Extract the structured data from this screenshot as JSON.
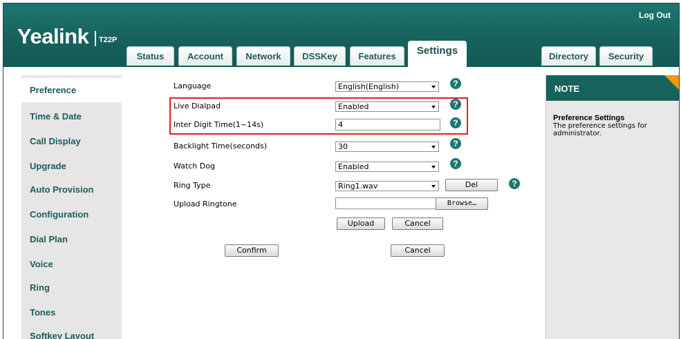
{
  "header": {
    "brand": "Yealink",
    "model": "T22P",
    "logout": "Log Out"
  },
  "tabs": [
    {
      "label": "Status"
    },
    {
      "label": "Account"
    },
    {
      "label": "Network"
    },
    {
      "label": "DSSKey"
    },
    {
      "label": "Features"
    },
    {
      "label": "Settings",
      "active": true
    },
    {
      "label": "Directory"
    },
    {
      "label": "Security"
    }
  ],
  "sidebar": {
    "items": [
      {
        "label": "Preference",
        "active": true
      },
      {
        "label": "Time & Date"
      },
      {
        "label": "Call Display"
      },
      {
        "label": "Upgrade"
      },
      {
        "label": "Auto Provision"
      },
      {
        "label": "Configuration"
      },
      {
        "label": "Dial Plan"
      },
      {
        "label": "Voice"
      },
      {
        "label": "Ring"
      },
      {
        "label": "Tones"
      },
      {
        "label": "Softkey Layout"
      }
    ]
  },
  "form": {
    "language": {
      "label": "Language",
      "value": "English(English)"
    },
    "live_dialpad": {
      "label": "Live Dialpad",
      "value": "Enabled"
    },
    "inter_digit": {
      "label": "Inter Digit Time(1~14s)",
      "value": "4"
    },
    "backlight": {
      "label": "Backlight Time(seconds)",
      "value": "30"
    },
    "watch_dog": {
      "label": "Watch Dog",
      "value": "Enabled"
    },
    "ring_type": {
      "label": "Ring Type",
      "value": "Ring1.wav",
      "del_button": "Del"
    },
    "upload_ringtone": {
      "label": "Upload Ringtone",
      "value": "",
      "browse_button": "Browse…",
      "upload_button": "Upload",
      "cancel_button": "Cancel"
    },
    "help_glyph": "?",
    "confirm_button": "Confirm",
    "cancel_button": "Cancel"
  },
  "note": {
    "heading": "NOTE",
    "title": "Preference Settings",
    "text": "The preference settings for administrator."
  },
  "colors": {
    "header_teal": "#17625d",
    "tab_text": "#1e5c5a",
    "highlight_red": "#e02020",
    "note_accent": "#f39800"
  }
}
